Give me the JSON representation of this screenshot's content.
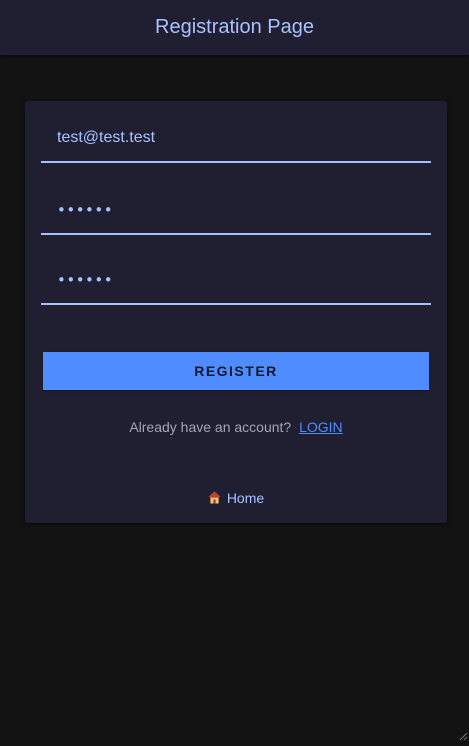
{
  "header": {
    "title": "Registration Page"
  },
  "form": {
    "email_value": "test@test.test",
    "password_value": "••••••",
    "confirm_password_value": "••••••",
    "register_label": "REGISTER"
  },
  "login": {
    "prompt": "Already have an account?",
    "link_label": "LOGIN"
  },
  "home": {
    "icon": "home-icon",
    "label": "Home"
  },
  "colors": {
    "background": "#131313",
    "surface": "#1f1f31",
    "accent": "#4f8cff",
    "text_light": "#a9c2ff",
    "text_muted": "#a5a5b0"
  }
}
